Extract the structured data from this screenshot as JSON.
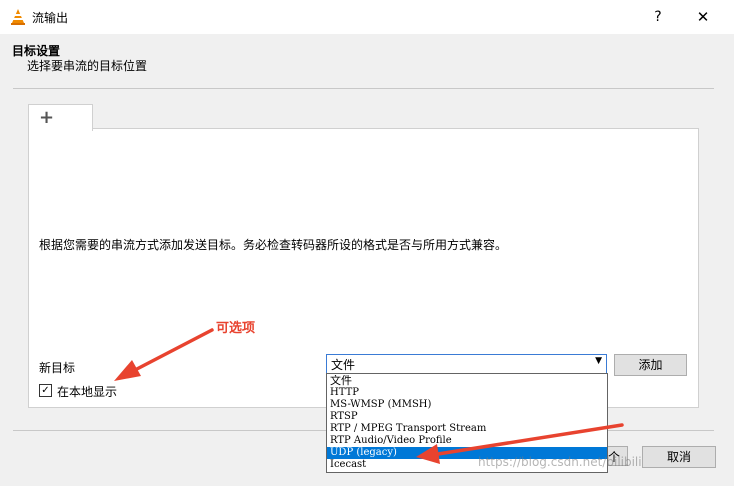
{
  "window": {
    "title": "流输出",
    "help_label": "?",
    "close_label": "✕"
  },
  "header": {
    "title": "目标设置",
    "subtitle": "选择要串流的目标位置"
  },
  "tabs": [
    {
      "label": "+"
    }
  ],
  "panel": {
    "instruction": "根据您需要的串流方式添加发送目标。务必检查转码器所设的格式是否与所用方式兼容。",
    "new_target_label": "新目标",
    "display_locally_label": "在本地显示",
    "display_locally_checked": true,
    "selected_option": "文件",
    "add_button": "添加"
  },
  "dropdown": {
    "options": [
      "文件",
      "HTTP",
      "MS-WMSP (MMSH)",
      "RTSP",
      "RTP / MPEG Transport Stream",
      "RTP Audio/Video Profile",
      "UDP (legacy)",
      "Icecast"
    ],
    "highlighted": "UDP (legacy)"
  },
  "footer": {
    "partial_button_text": "个",
    "cancel_button": "取消"
  },
  "annotation": {
    "text": "可选项",
    "color": "#e8432f"
  },
  "watermark": {
    "text": "https://blog.csdn.net/bilibili"
  },
  "colors": {
    "highlight": "#0078d7",
    "select_border": "#3a7bd5",
    "annotation": "#e8432f"
  }
}
